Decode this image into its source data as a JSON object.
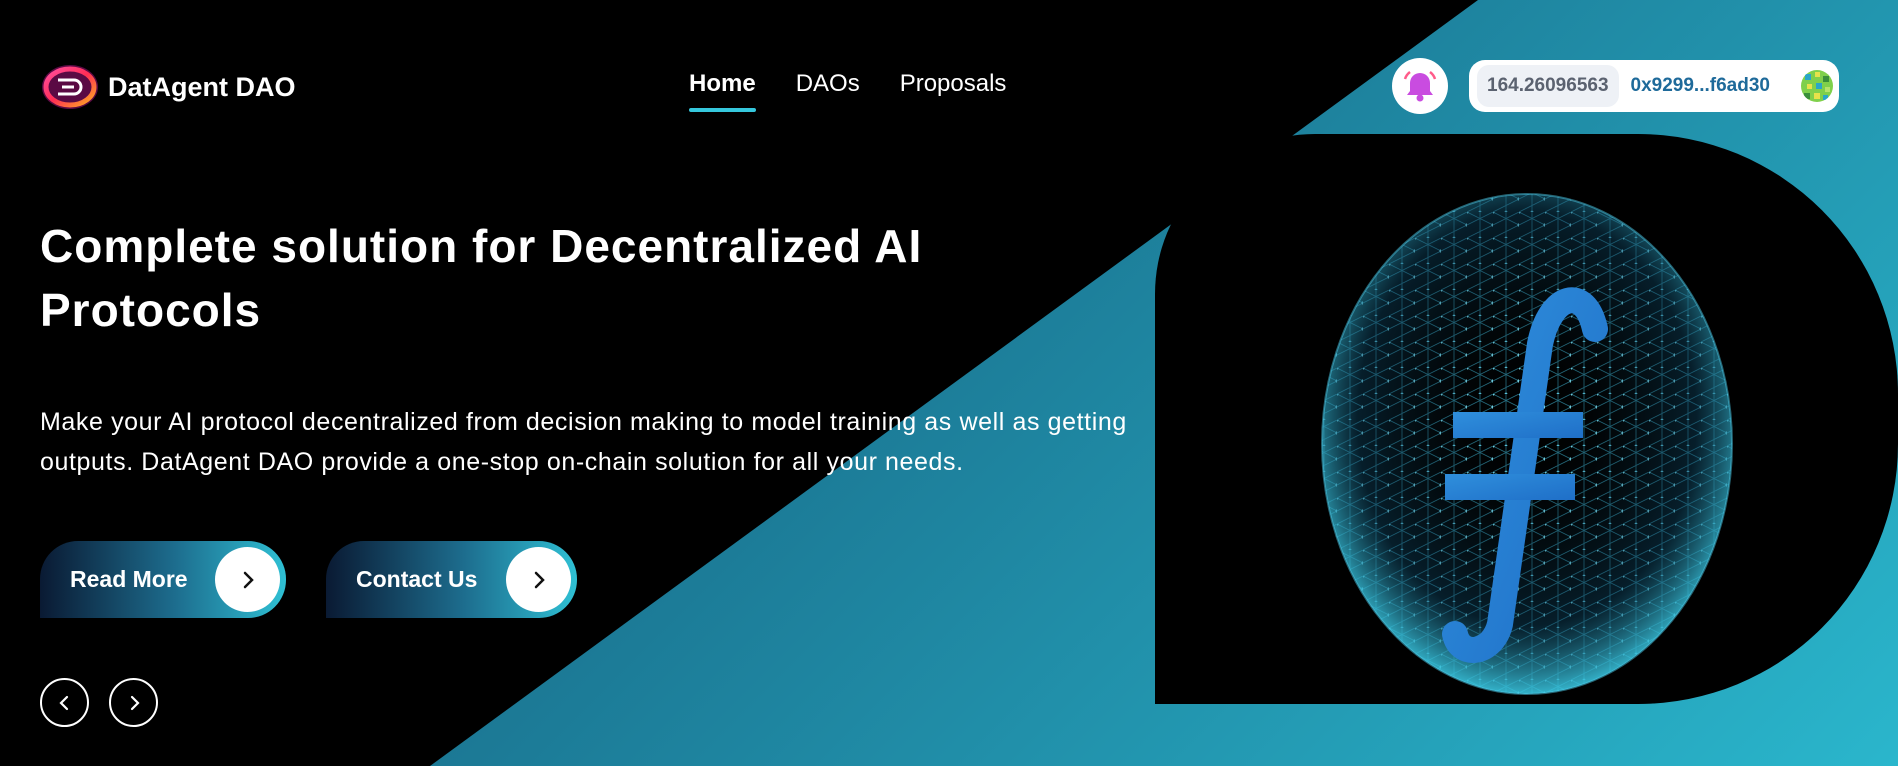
{
  "brand": {
    "name": "DatAgent DAO",
    "logo_icon": "dao-logo-icon"
  },
  "nav": {
    "items": [
      {
        "label": "Home",
        "active": true
      },
      {
        "label": "DAOs",
        "active": false
      },
      {
        "label": "Proposals",
        "active": false
      }
    ]
  },
  "notifications": {
    "icon": "bell-icon",
    "color": "#c94ce0"
  },
  "wallet": {
    "balance": "164.26096563",
    "address": "0x9299...f6ad30",
    "avatar_icon": "wallet-avatar-icon"
  },
  "hero": {
    "title": "Complete solution for Decentralized AI Protocols",
    "description": "Make your AI protocol decentralized from decision making to model training as well as getting outputs. DatAgent DAO provide a one-stop on-chain solution for all your needs.",
    "buttons": {
      "read_more": "Read More",
      "contact_us": "Contact Us"
    },
    "arrow_icon": "chevron-right-icon"
  },
  "carousel": {
    "prev_icon": "chevron-left-icon",
    "next_icon": "chevron-right-icon"
  },
  "illustration": {
    "icon": "filecoin-sphere-icon"
  },
  "colors": {
    "accent": "#35c7dc",
    "background": "#000000",
    "gradient_end": "#2ab6cc"
  }
}
